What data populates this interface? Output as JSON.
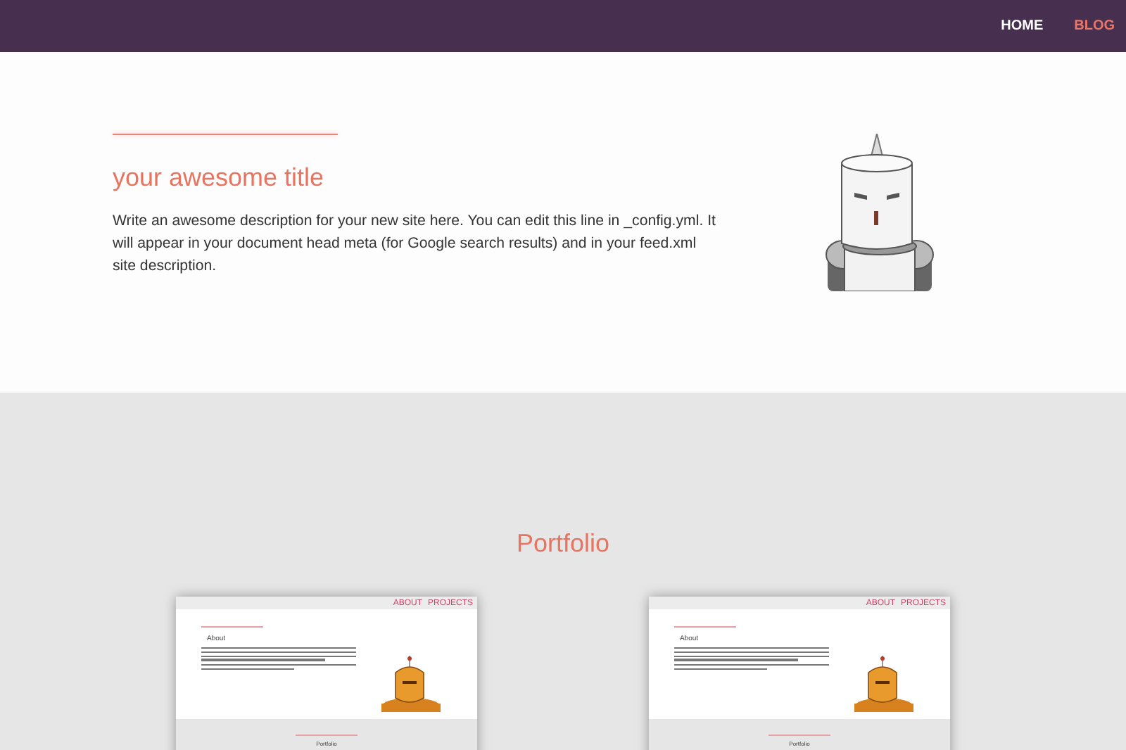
{
  "nav": [
    {
      "label": "HOME",
      "selected": false
    },
    {
      "label": "BLOG",
      "selected": true
    }
  ],
  "hero": {
    "title": "your awesome title",
    "description": "Write an awesome description for your new site here. You can edit this line in _config.yml. It will appear in your document head meta (for Google search results) and in your feed.xml site description."
  },
  "portfolio": {
    "title": "Portfolio",
    "projects": [
      {
        "nav": [
          "ABOUT",
          "PROJECTS"
        ],
        "heading": "About",
        "section_title": "Portfolio"
      },
      {
        "nav": [
          "ABOUT",
          "PROJECTS"
        ],
        "heading": "About",
        "section_title": "Portfolio"
      }
    ]
  }
}
